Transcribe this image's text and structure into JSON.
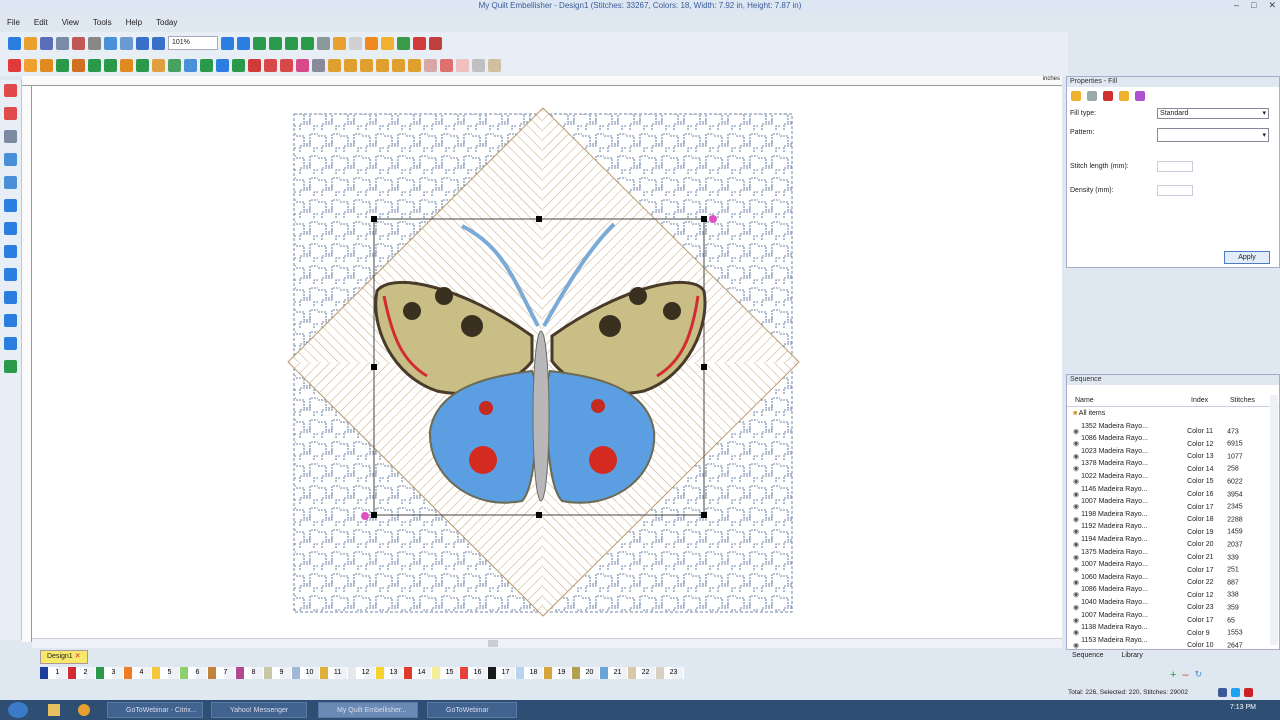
{
  "window": {
    "title": "My Quilt Embellisher - Design1 (Stitches: 33267, Colors: 18, Width: 7.92 in, Height: 7.87 in)"
  },
  "menus": [
    "File",
    "Edit",
    "View",
    "Tools",
    "Help",
    "Today"
  ],
  "toolbar": {
    "zoom": "101%"
  },
  "ruler": {
    "units": "inches"
  },
  "document_tab": "Design1",
  "palette": {
    "numbers": [
      "1",
      "2",
      "3",
      "4",
      "5",
      "6",
      "7",
      "8",
      "9",
      "10",
      "11",
      "12",
      "13",
      "14",
      "15",
      "16",
      "17",
      "18",
      "19",
      "20",
      "21",
      "22",
      "23"
    ],
    "colors": [
      "#1b3f9a",
      "#d42a32",
      "#2a9a4a",
      "#f07b22",
      "#f5c83a",
      "#8fcf6e",
      "#c3823a",
      "#b3488e",
      "#c8c8a8",
      "#9fb8d6",
      "#e0b03a",
      "#e8e8e8",
      "#f7d22c",
      "#e03a2a",
      "#f5ef9a",
      "#e8413c",
      "#1a1a1a",
      "#b8d4ef",
      "#d6a63a",
      "#b0a050",
      "#6aa5d6",
      "#d8c8a8",
      "#d8d0c0"
    ]
  },
  "properties": {
    "title": "Properties - Fill",
    "fill_type_label": "Fill type:",
    "fill_type_value": "Standard",
    "pattern_label": "Pattern:",
    "stitch_length_label": "Stitch length (mm):",
    "density_label": "Density (mm):",
    "apply": "Apply"
  },
  "sequence": {
    "title": "Sequence",
    "columns": [
      "Name",
      "Index",
      "Stitches"
    ],
    "all_items": "All items",
    "rows": [
      {
        "name": "1352 Madeira Rayo...",
        "index": "Color 11",
        "stitches": "473"
      },
      {
        "name": "1086 Madeira Rayo...",
        "index": "Color 12",
        "stitches": "6915"
      },
      {
        "name": "1023 Madeira Rayo...",
        "index": "Color 13",
        "stitches": "1077"
      },
      {
        "name": "1378 Madeira Rayo...",
        "index": "Color 14",
        "stitches": "258"
      },
      {
        "name": "1022 Madeira Rayo...",
        "index": "Color 15",
        "stitches": "6022"
      },
      {
        "name": "1146 Madeira Rayo...",
        "index": "Color 16",
        "stitches": "3954"
      },
      {
        "name": "1007 Madeira Rayo...",
        "index": "Color 17",
        "stitches": "2345"
      },
      {
        "name": "1198 Madeira Rayo...",
        "index": "Color 18",
        "stitches": "2288"
      },
      {
        "name": "1192 Madeira Rayo...",
        "index": "Color 19",
        "stitches": "1459"
      },
      {
        "name": "1194 Madeira Rayo...",
        "index": "Color 20",
        "stitches": "2037"
      },
      {
        "name": "1375 Madeira Rayo...",
        "index": "Color 21",
        "stitches": "339"
      },
      {
        "name": "1007 Madeira Rayo...",
        "index": "Color 17",
        "stitches": "251"
      },
      {
        "name": "1060 Madeira Rayo...",
        "index": "Color 22",
        "stitches": "887"
      },
      {
        "name": "1086 Madeira Rayo...",
        "index": "Color 12",
        "stitches": "338"
      },
      {
        "name": "1040 Madeira Rayo...",
        "index": "Color 23",
        "stitches": "359"
      },
      {
        "name": "1007 Madeira Rayo...",
        "index": "Color 17",
        "stitches": "65"
      },
      {
        "name": "1138 Madeira Rayo...",
        "index": "Color 9",
        "stitches": "1553"
      },
      {
        "name": "1153 Madeira Rayo...",
        "index": "Color 10",
        "stitches": "2647"
      }
    ],
    "tabs": [
      "Sequence",
      "Library"
    ]
  },
  "status": "Total: 226, Selected: 220, Stitches: 29002",
  "taskbar": {
    "items": [
      "GoToWebinar - Citrix...",
      "Yahoo! Messenger",
      "My Quilt Embellisher...",
      "GoToWebinar"
    ],
    "time": "7:13 PM"
  }
}
